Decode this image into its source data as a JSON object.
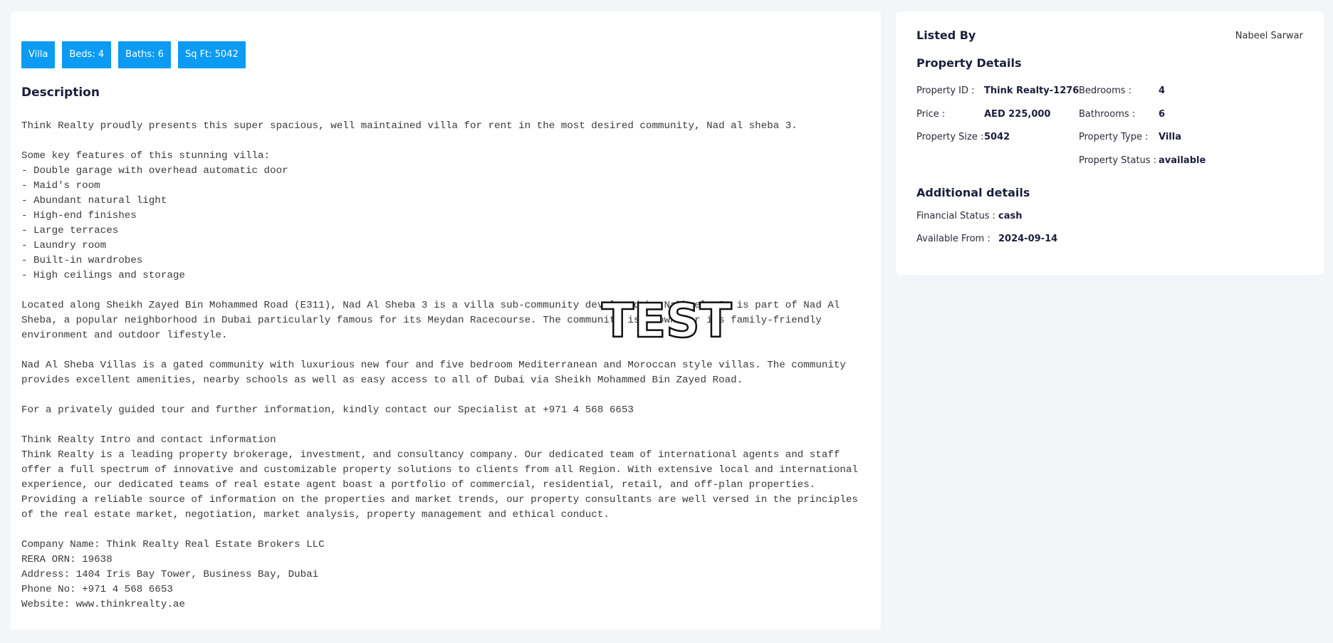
{
  "tags": [
    "Villa",
    "Beds: 4",
    "Baths: 6",
    "Sq Ft: 5042"
  ],
  "description": {
    "heading": "Description",
    "lines": [
      "Think Realty proudly presents this super spacious, well maintained villa for rent in the most desired community, Nad al sheba 3.",
      "",
      "Some key features of this stunning villa:",
      "- Double garage with overhead automatic door",
      "- Maid's room",
      "- Abundant natural light",
      "- High-end finishes",
      "- Large terraces",
      "- Laundry room",
      "- Built-in wardrobes",
      "- High ceilings and storage",
      "",
      "Located along Sheikh Zayed Bin Mohammed Road (E311), Nad Al Sheba 3 is a villa sub-community developed by Nakheel. It is part of Nad Al",
      "Sheba, a popular neighborhood in Dubai particularly famous for its Meydan Racecourse. The community is known for its family-friendly",
      "environment and outdoor lifestyle.",
      "",
      "Nad Al Sheba Villas is a gated community with luxurious new four and five bedroom Mediterranean and Moroccan style villas. The community",
      "provides excellent amenities, nearby schools as well as easy access to all of Dubai via Sheikh Mohammed Bin Zayed Road.",
      "",
      "For a privately guided tour and further information, kindly contact our Specialist at +971 4 568 6653",
      "",
      "Think Realty Intro and contact information",
      "Think Realty is a leading property brokerage, investment, and consultancy company. Our dedicated team of international agents and staff",
      "offer a full spectrum of innovative and customizable property solutions to clients from all Region. With extensive local and international",
      "experience, our dedicated teams of real estate agent boast a portfolio of commercial, residential, retail, and off-plan properties.",
      "Providing a reliable source of information on the properties and market trends, our property consultants are well versed in the principles",
      "of the real estate market, negotiation, market analysis, property management and ethical conduct.",
      "",
      "Company Name: Think Realty Real Estate Brokers LLC",
      "RERA ORN: 19638",
      "Address: 1404 Iris Bay Tower, Business Bay, Dubai",
      "Phone No: +971 4 568 6653",
      "Website: www.thinkrealty.ae"
    ]
  },
  "sidebar": {
    "listed_by_label": "Listed By",
    "listed_by_name": "Nabeel Sarwar",
    "property_details_title": "Property Details",
    "details": {
      "property_id": {
        "label": "Property ID :",
        "value": "Think Realty-1276"
      },
      "price": {
        "label": "Price :",
        "value": "AED 225,000"
      },
      "property_size": {
        "label": "Property Size :",
        "value": "5042"
      },
      "bedrooms": {
        "label": "Bedrooms :",
        "value": "4"
      },
      "bathrooms": {
        "label": "Bathrooms :",
        "value": "6"
      },
      "property_type": {
        "label": "Property Type :",
        "value": "Villa"
      },
      "property_status": {
        "label": "Property Status :",
        "value": "available"
      }
    },
    "additional_title": "Additional details",
    "additional": {
      "financial_status": {
        "label": "Financial Status :",
        "value": "cash"
      },
      "available_from": {
        "label": "Available From :",
        "value": "2024-09-14"
      }
    }
  },
  "watermark": "TEST"
}
